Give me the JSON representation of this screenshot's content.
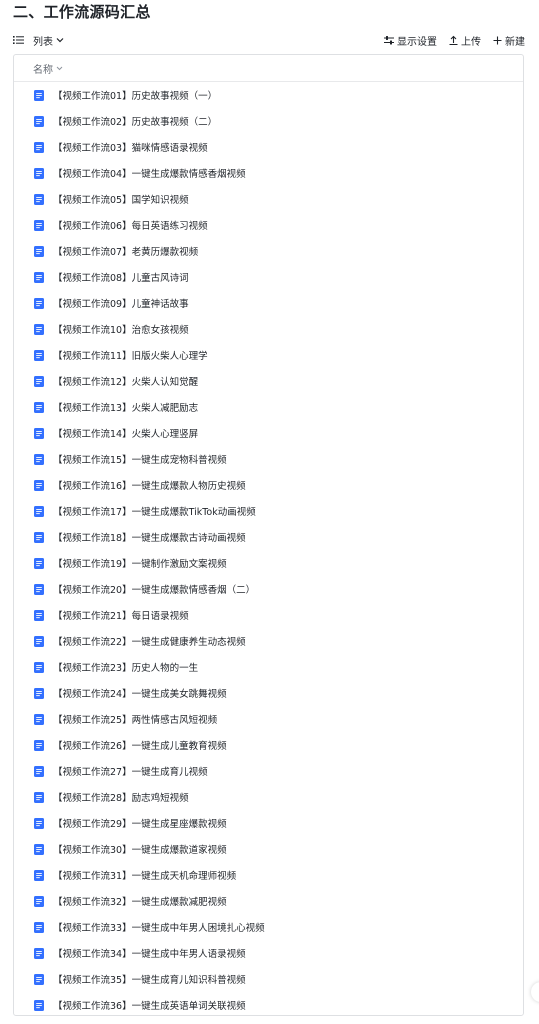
{
  "page_title": "二、工作流源码汇总",
  "toolbar": {
    "view_label": "列表",
    "display_settings_label": "显示设置",
    "upload_label": "上传",
    "new_label": "新建"
  },
  "list": {
    "column_name": "名称",
    "items": [
      "【视频工作流01】历史故事视频（一）",
      "【视频工作流02】历史故事视频（二）",
      "【视频工作流03】猫咪情感语录视频",
      "【视频工作流04】一键生成爆款情感香烟视频",
      "【视频工作流05】国学知识视频",
      "【视频工作流06】每日英语练习视频",
      "【视频工作流07】老黄历爆款视频",
      "【视频工作流08】儿童古风诗词",
      "【视频工作流09】儿童神话故事",
      "【视频工作流10】治愈女孩视频",
      "【视频工作流11】旧版火柴人心理学",
      "【视频工作流12】火柴人认知觉醒",
      "【视频工作流13】火柴人减肥励志",
      "【视频工作流14】火柴人心理竖屏",
      "【视频工作流15】一键生成宠物科普视频",
      "【视频工作流16】一键生成爆款人物历史视频",
      "【视频工作流17】一键生成爆款TikTok动画视频",
      "【视频工作流18】一键生成爆款古诗动画视频",
      "【视频工作流19】一键制作激励文案视频",
      "【视频工作流20】一键生成爆款情感香烟（二）",
      "【视频工作流21】每日语录视频",
      "【视频工作流22】一键生成健康养生动态视频",
      "【视频工作流23】历史人物的一生",
      "【视频工作流24】一键生成美女跳舞视频",
      "【视频工作流25】两性情感古风短视频",
      "【视频工作流26】一键生成儿童教育视频",
      "【视频工作流27】一键生成育儿视频",
      "【视频工作流28】励志鸡短视频",
      "【视频工作流29】一键生成星座爆款视频",
      "【视频工作流30】一键生成爆款道家视频",
      "【视频工作流31】一键生成天机命理师视频",
      "【视频工作流32】一键生成爆款减肥视频",
      "【视频工作流33】一键生成中年男人困境扎心视频",
      "【视频工作流34】一键生成中年男人语录视频",
      "【视频工作流35】一键生成育儿知识科普视频",
      "【视频工作流36】一键生成英语单词关联视频"
    ]
  },
  "colors": {
    "doc_icon": "#3370ff",
    "border": "#dee0e3",
    "muted_text": "#646a73"
  }
}
